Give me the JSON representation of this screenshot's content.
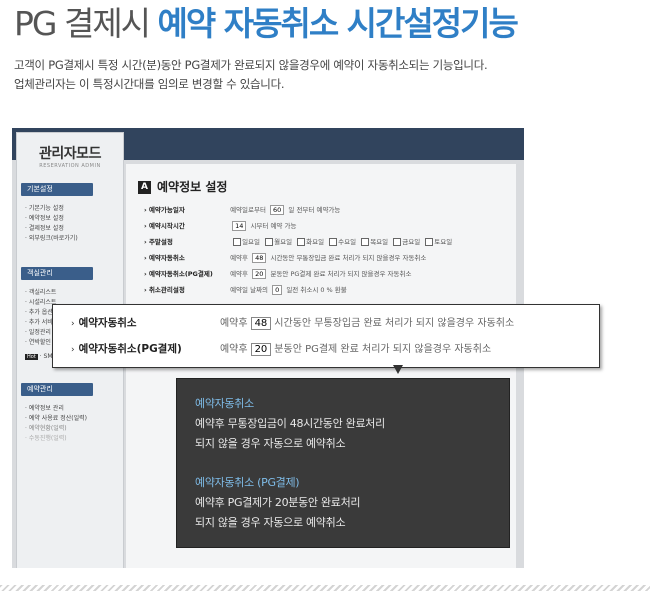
{
  "header": {
    "title_prefix": "PG 결제시",
    "title_highlight": "예약 자동취소 시간설정기능",
    "desc_line1": "고객이 PG결제시 특정 시간(분)동안 PG결제가 완료되지 않을경우에 예약이 자동취소되는 기능입니다.",
    "desc_line2": "업체관리자는 이 특정시간대를 임의로 변경할 수 있습니다."
  },
  "admin": {
    "logo_title": "관리자모드",
    "logo_sub": "RESERVATION ADMIN",
    "sidebar": {
      "head1": "기본설정",
      "items1": [
        "· 기본기능 설정",
        "· 예약정보 설정",
        "· 결제정보 설정",
        "· 외부링크(바로가기)"
      ],
      "head2": "객실관리",
      "items2": [
        "· 객실리스트",
        "· 시설리스트",
        "· 추가 옵션",
        "· 추가 서비",
        "· 일정관리",
        "· 연박할인",
        "· SM"
      ],
      "badge": "Hot",
      "head3": "예약관리",
      "items3": [
        "· 예약정보 관리",
        "· 예약 사용료 정산(일력)",
        "· 예약현황(일력)",
        "· 수동진행(일력)"
      ]
    },
    "section_badge": "A",
    "section_title": "예약정보 설정",
    "rows": [
      {
        "label": "› 예약가능일자",
        "pre": "예약일로부터",
        "num": "60",
        "post": "일 전부터 예약가능"
      },
      {
        "label": "› 예약시작시간",
        "pre": "",
        "num": "14",
        "post": "시부터 예약 가능"
      },
      {
        "label": "› 주말설정",
        "days": [
          "일요일",
          "월요일",
          "화요일",
          "수요일",
          "목요일",
          "금요일",
          "토요일"
        ]
      },
      {
        "label": "› 예약자동취소",
        "pre": "예약후",
        "num": "48",
        "post": "시간동안 무통장입금 완료 처리가 되지 않을경우 자동취소"
      },
      {
        "label": "› 예약자동취소(PG결제)",
        "pre": "예약후",
        "num": "20",
        "post": "분동안 PG결제 완료 처리가 되지 않을경우 자동취소"
      },
      {
        "label": "› 취소관리설정",
        "pre": "예약일 날짜의",
        "num": "0",
        "post": "일전 취소시  0  % 환불"
      }
    ]
  },
  "callout": {
    "rows": [
      {
        "label": "예약자동취소",
        "pre": "예약후",
        "num": "48",
        "post": "시간동안 무통장입금 완료 처리가 되지 않을경우 자동취소"
      },
      {
        "label": "예약자동취소(PG결제)",
        "pre": "예약후",
        "num": "20",
        "post": "분동안 PG결제 완료 처리가 되지 않을경우 자동취소"
      }
    ]
  },
  "tooltip": {
    "h1": "예약자동취소",
    "l1": "예약후 무통장입금이 48시간동안 완료처리",
    "l2": "되지 않을 경우 자동으로 예약취소",
    "h2": "예약자동취소 (PG결제)",
    "l3": "예약후 PG결제가 20분동안 완료처리",
    "l4": "되지 않을 경우 자동으로 예약취소"
  }
}
